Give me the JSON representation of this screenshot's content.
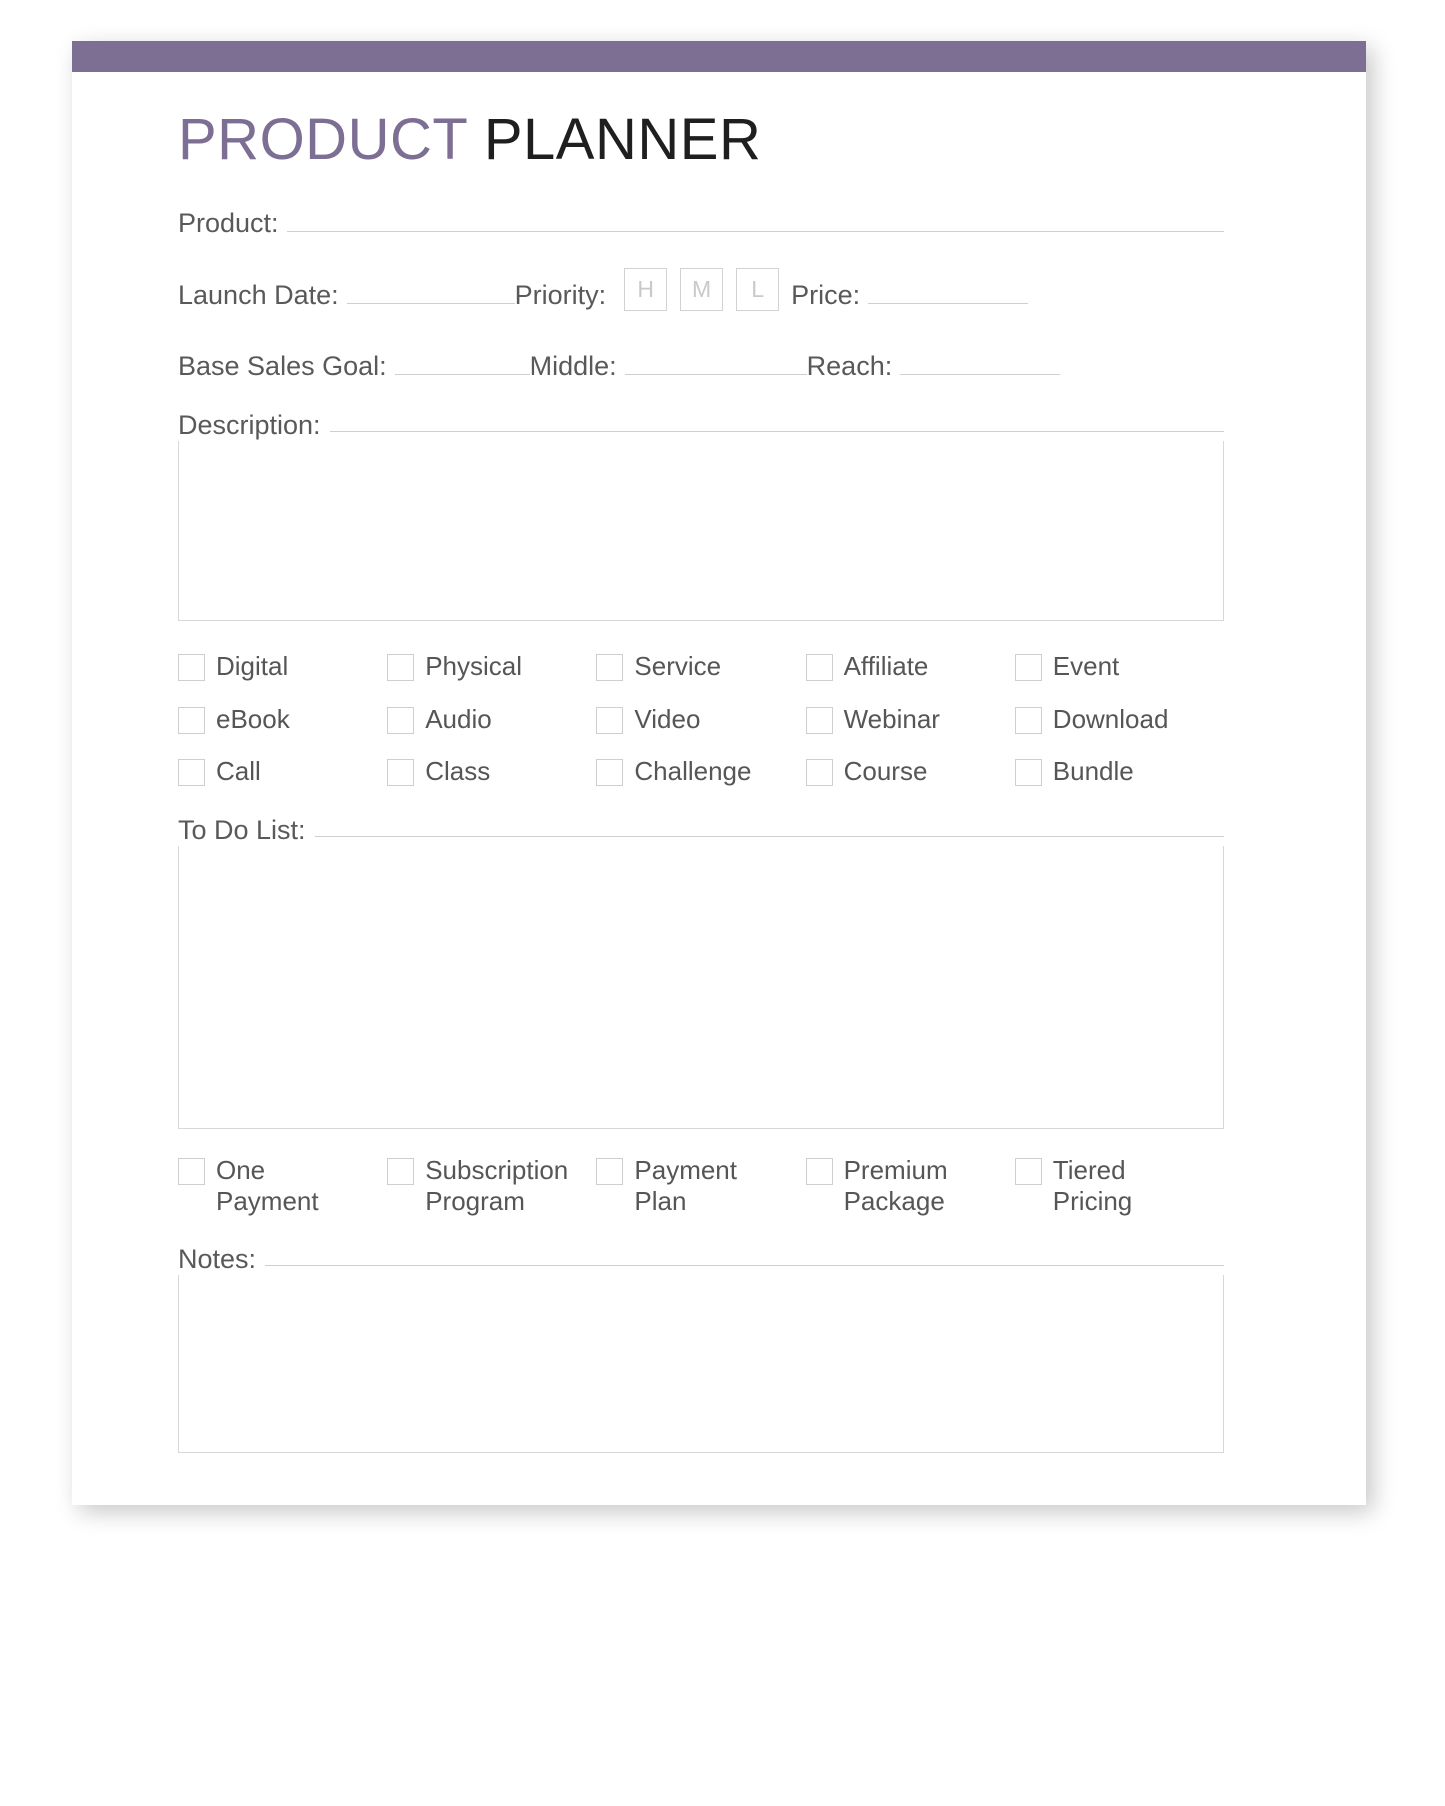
{
  "document": {
    "title_accent": "PRODUCT",
    "title_plain": "PLANNER",
    "accent_color": "#7d6e93",
    "text_color": "#595959",
    "rule_color": "#cfcfcf"
  },
  "fields": {
    "product_label": "Product:",
    "product_value": "",
    "launch_date_label": "Launch Date:",
    "launch_date_value": "",
    "priority_label": "Priority:",
    "priority_options": [
      "H",
      "M",
      "L"
    ],
    "price_label": "Price:",
    "price_value": "",
    "base_sales_goal_label": "Base Sales Goal:",
    "base_sales_goal_value": "",
    "middle_label": "Middle:",
    "middle_value": "",
    "reach_label": "Reach:",
    "reach_value": ""
  },
  "sections": {
    "description": {
      "label": "Description:",
      "value": ""
    },
    "todo": {
      "label": "To Do List:",
      "value": ""
    },
    "notes": {
      "label": "Notes:",
      "value": ""
    }
  },
  "product_types": [
    "Digital",
    "Physical",
    "Service",
    "Affiliate",
    "Event",
    "eBook",
    "Audio",
    "Video",
    "Webinar",
    "Download",
    "Call",
    "Class",
    "Challenge",
    "Course",
    "Bundle"
  ],
  "payment_options": [
    "One\nPayment",
    "Subscription\nProgram",
    "Payment\nPlan",
    "Premium\nPackage",
    "Tiered\nPricing"
  ]
}
